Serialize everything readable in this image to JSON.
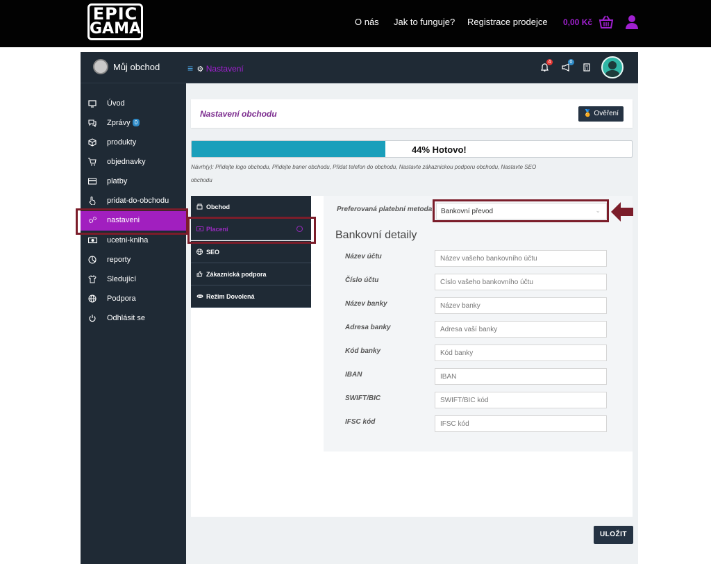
{
  "brand": {
    "line1": "EPIC",
    "line2": "GAMA"
  },
  "topnav": {
    "about": "O nás",
    "how": "Jak to funguje?",
    "register": "Registrace prodejce",
    "cart_amount": "0,00 Kč"
  },
  "header": {
    "shop_name": "Můj obchod",
    "section": "Nastavení",
    "notif_count": "4",
    "announce_count": "0"
  },
  "sidebar": {
    "items": [
      {
        "label": "Úvod",
        "icon": "monitor-icon"
      },
      {
        "label": "Zprávy",
        "icon": "chat-icon",
        "badge": "0"
      },
      {
        "label": "produkty",
        "icon": "box-icon"
      },
      {
        "label": "objednavky",
        "icon": "cart-icon"
      },
      {
        "label": "platby",
        "icon": "credit-card-icon"
      },
      {
        "label": "pridat-do-obchodu",
        "icon": "hand-pointer-icon"
      },
      {
        "label": "nastaveni",
        "icon": "gears-icon",
        "active": true
      },
      {
        "label": "ucetni-kniha",
        "icon": "money-icon"
      },
      {
        "label": "reporty",
        "icon": "pie-chart-icon"
      },
      {
        "label": "Sledující",
        "icon": "shirt-icon"
      },
      {
        "label": "Podpora",
        "icon": "globe-icon"
      },
      {
        "label": "Odhlásit se",
        "icon": "power-icon"
      }
    ]
  },
  "page": {
    "title": "Nastavení obchodu",
    "verify_label": "Ověření",
    "progress_percent": 44,
    "progress_text": "44% Hotovo!",
    "suggestions": "Návrh(y): Přidejte logo obchodu, Přidejte baner obchodu, Přidat telefon do obchodu, Nastavte zákaznickou podporu obchodu, Nastavte SEO obchodu"
  },
  "tabs": [
    {
      "label": "Obchod",
      "icon": "store-icon"
    },
    {
      "label": "Placení",
      "icon": "money-icon",
      "active": true
    },
    {
      "label": "SEO",
      "icon": "globe-icon"
    },
    {
      "label": "Zákaznická podpora",
      "icon": "thumbs-up-icon"
    },
    {
      "label": "Režim Dovolená",
      "icon": "plane-icon"
    }
  ],
  "payment": {
    "method_label": "Preferovaná platební metoda",
    "method_value": "Bankovní převod",
    "bank_heading": "Bankovní detaily",
    "fields": [
      {
        "label": "Název účtu",
        "placeholder": "Název vašeho bankovního účtu"
      },
      {
        "label": "Číslo účtu",
        "placeholder": "Číslo vašeho bankovního účtu"
      },
      {
        "label": "Název banky",
        "placeholder": "Název banky"
      },
      {
        "label": "Adresa banky",
        "placeholder": "Adresa vaší banky"
      },
      {
        "label": "Kód banky",
        "placeholder": "Kód banky"
      },
      {
        "label": "IBAN",
        "placeholder": "IBAN"
      },
      {
        "label": "SWIFT/BIC",
        "placeholder": "SWIFT/BIC kód"
      },
      {
        "label": "IFSC kód",
        "placeholder": "IFSC kód"
      }
    ],
    "save_label": "ULOŽIT"
  },
  "colors": {
    "accent": "#a11fbf",
    "dark": "#1f2a35",
    "progress": "#1a9fbb",
    "annotation": "#7b1d2a"
  }
}
